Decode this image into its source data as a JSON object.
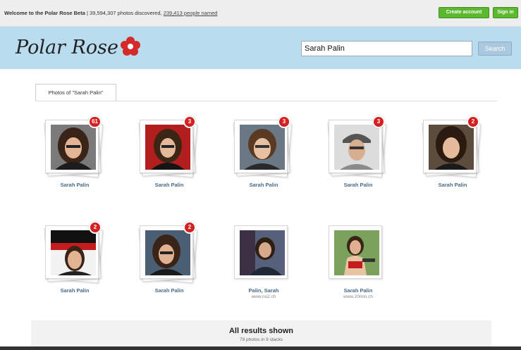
{
  "topbar": {
    "welcome": "Welcome to the Polar Rose Beta",
    "separator": " | ",
    "photos_discovered": "39,594,307 photos discovered,",
    "people_named": "239,413 people named",
    "create_account": "Create account",
    "sign_in": "Sign in",
    "accent": "#5cb82e"
  },
  "header": {
    "logo": "Polar Rose",
    "search_value": "Sarah Palin",
    "search_button": "Search",
    "background": "#b9dcef"
  },
  "tab": {
    "label": "Photos of \"Sarah Palin\""
  },
  "photos": [
    {
      "name": "Sarah Palin",
      "count": "61",
      "source": ""
    },
    {
      "name": "Sarah Palin",
      "count": "3",
      "source": ""
    },
    {
      "name": "Sarah Palin",
      "count": "3",
      "source": ""
    },
    {
      "name": "Sarah Palin",
      "count": "3",
      "source": ""
    },
    {
      "name": "Sarah Palin",
      "count": "2",
      "source": ""
    },
    {
      "name": "Sarah Palin",
      "count": "2",
      "source": ""
    },
    {
      "name": "Sarah Palin",
      "count": "2",
      "source": ""
    },
    {
      "name": "Palin, Sarah",
      "count": "",
      "source": "www.no2.ch"
    },
    {
      "name": "Sarah Palin",
      "count": "",
      "source": "www.20min.ch"
    }
  ],
  "results": {
    "title": "All results shown",
    "subtitle": "79 photos in 9 stacks"
  },
  "badge_color": "#d42020"
}
